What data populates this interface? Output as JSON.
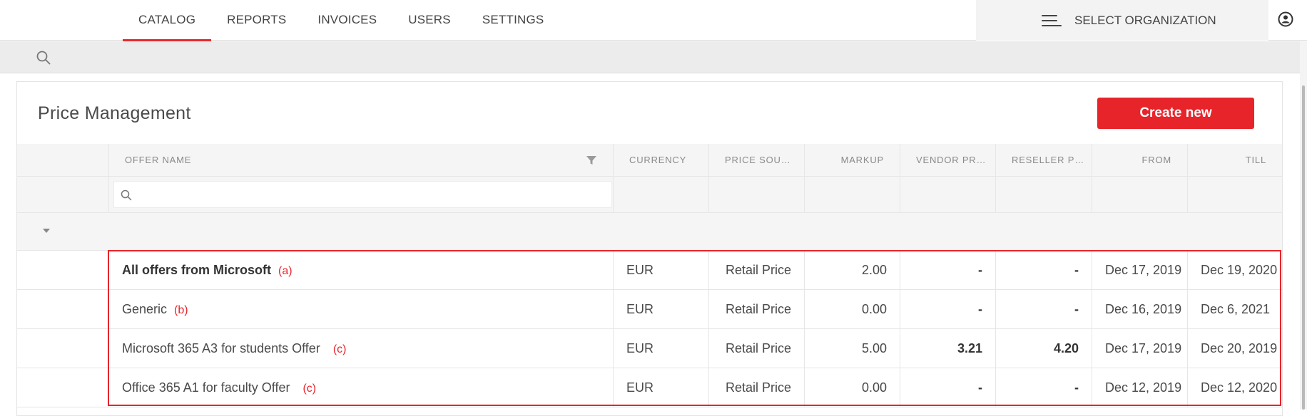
{
  "nav": {
    "tabs": [
      {
        "label": "CATALOG",
        "active": true
      },
      {
        "label": "REPORTS",
        "active": false
      },
      {
        "label": "INVOICES",
        "active": false
      },
      {
        "label": "USERS",
        "active": false
      },
      {
        "label": "SETTINGS",
        "active": false
      }
    ],
    "org_label": "SELECT ORGANIZATION",
    "icons": {
      "menu": "hamburger-icon",
      "user": "user-account-icon",
      "search": "search-icon"
    }
  },
  "page": {
    "title": "Price Management",
    "create_button": "Create new"
  },
  "colors": {
    "accent": "#e8242b",
    "header_bg": "#f5f5f5",
    "strip_bg": "#ececec"
  },
  "table": {
    "columns": [
      "OFFER NAME",
      "CURRENCY",
      "PRICE SOU…",
      "MARKUP",
      "VENDOR PR…",
      "RESELLER P…",
      "FROM",
      "TILL"
    ],
    "rows": [
      {
        "name": "All offers from Microsoft",
        "tag": "(a)",
        "currency": "EUR",
        "source": "Retail Price",
        "markup": "2.00",
        "vendor": "-",
        "reseller": "-",
        "from": "Dec 17, 2019",
        "till": "Dec 19, 2020"
      },
      {
        "name": "Generic",
        "tag": "(b)",
        "currency": "EUR",
        "source": "Retail Price",
        "markup": "0.00",
        "vendor": "-",
        "reseller": "-",
        "from": "Dec 16, 2019",
        "till": "Dec 6, 2021"
      },
      {
        "name": "Microsoft 365 A3 for students Offer",
        "tag": "(c)",
        "currency": "EUR",
        "source": "Retail Price",
        "markup": "5.00",
        "vendor": "3.21",
        "reseller": "4.20",
        "from": "Dec 17, 2019",
        "till": "Dec 20, 2019"
      },
      {
        "name": "Office 365 A1 for faculty Offer",
        "tag": "(c)",
        "currency": "EUR",
        "source": "Retail Price",
        "markup": "0.00",
        "vendor": "-",
        "reseller": "-",
        "from": "Dec 12, 2019",
        "till": "Dec 12, 2020"
      }
    ]
  }
}
